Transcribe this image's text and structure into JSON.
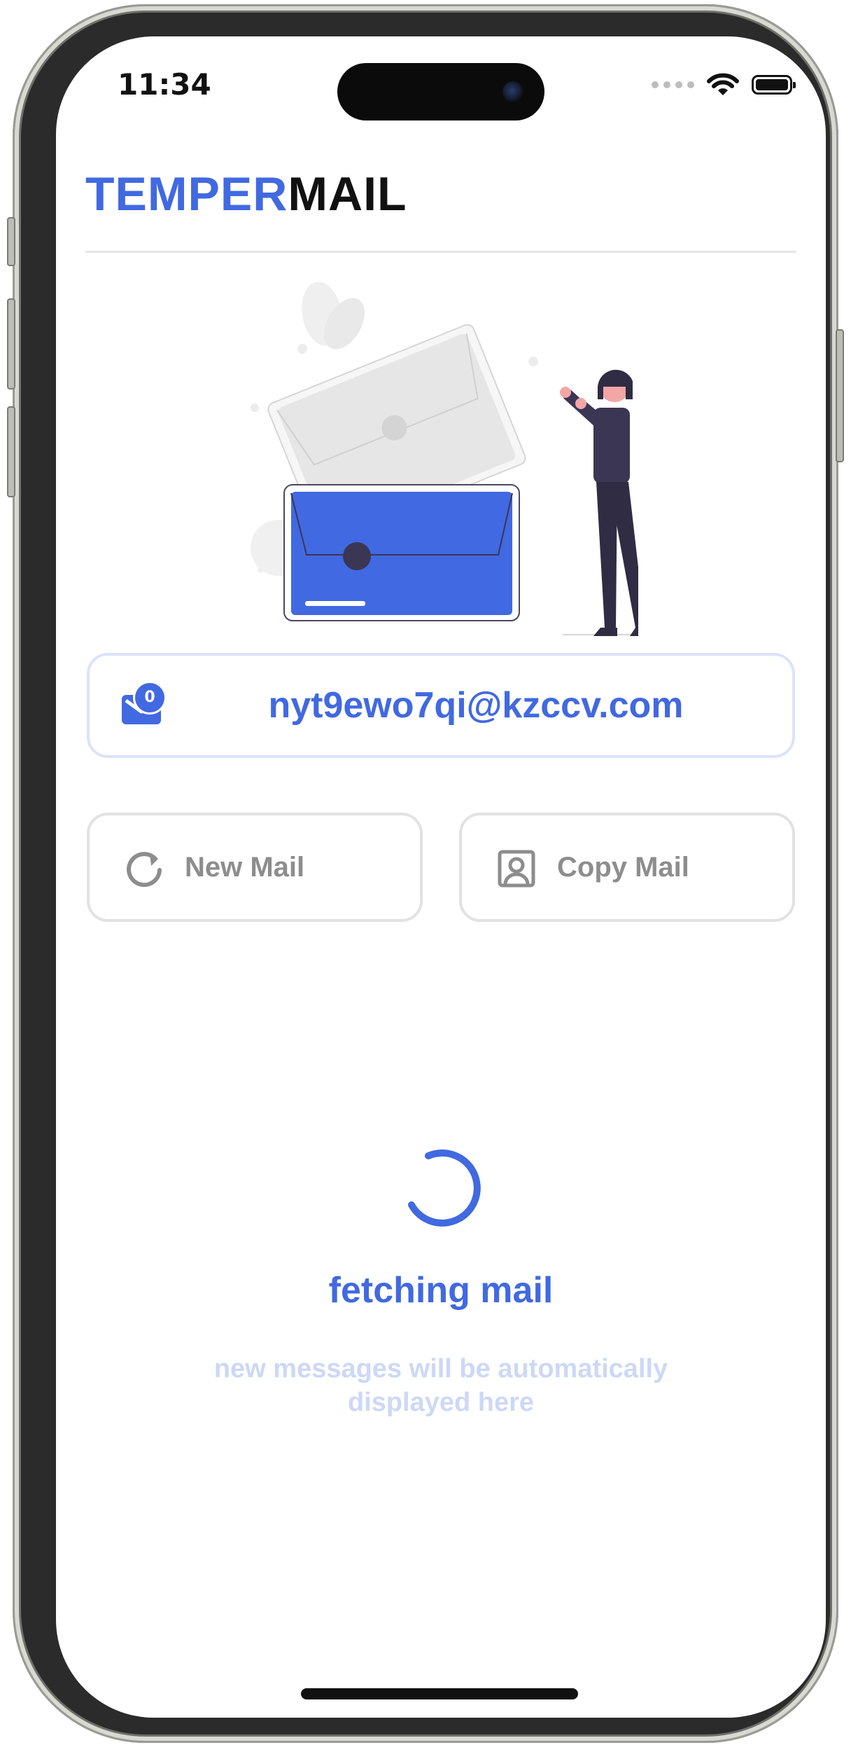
{
  "status_bar": {
    "time": "11:34",
    "icons": [
      "cellular-dots-icon",
      "wifi-icon",
      "battery-icon"
    ]
  },
  "header": {
    "logo_part1": "TEMPER",
    "logo_part2": "MAIL"
  },
  "email": {
    "address": "nyt9ewo7qi@kzccv.com",
    "unread_count": "0"
  },
  "actions": {
    "new_mail_label": "New Mail",
    "copy_mail_label": "Copy Mail"
  },
  "inbox": {
    "status_title": "fetching mail",
    "status_subtitle": "new messages will be automatically displayed here"
  },
  "colors": {
    "accent": "#4169e1",
    "button_border": "#e2e2e2",
    "muted_text": "#8d8d8d",
    "faint_text": "#cdd8f6"
  }
}
